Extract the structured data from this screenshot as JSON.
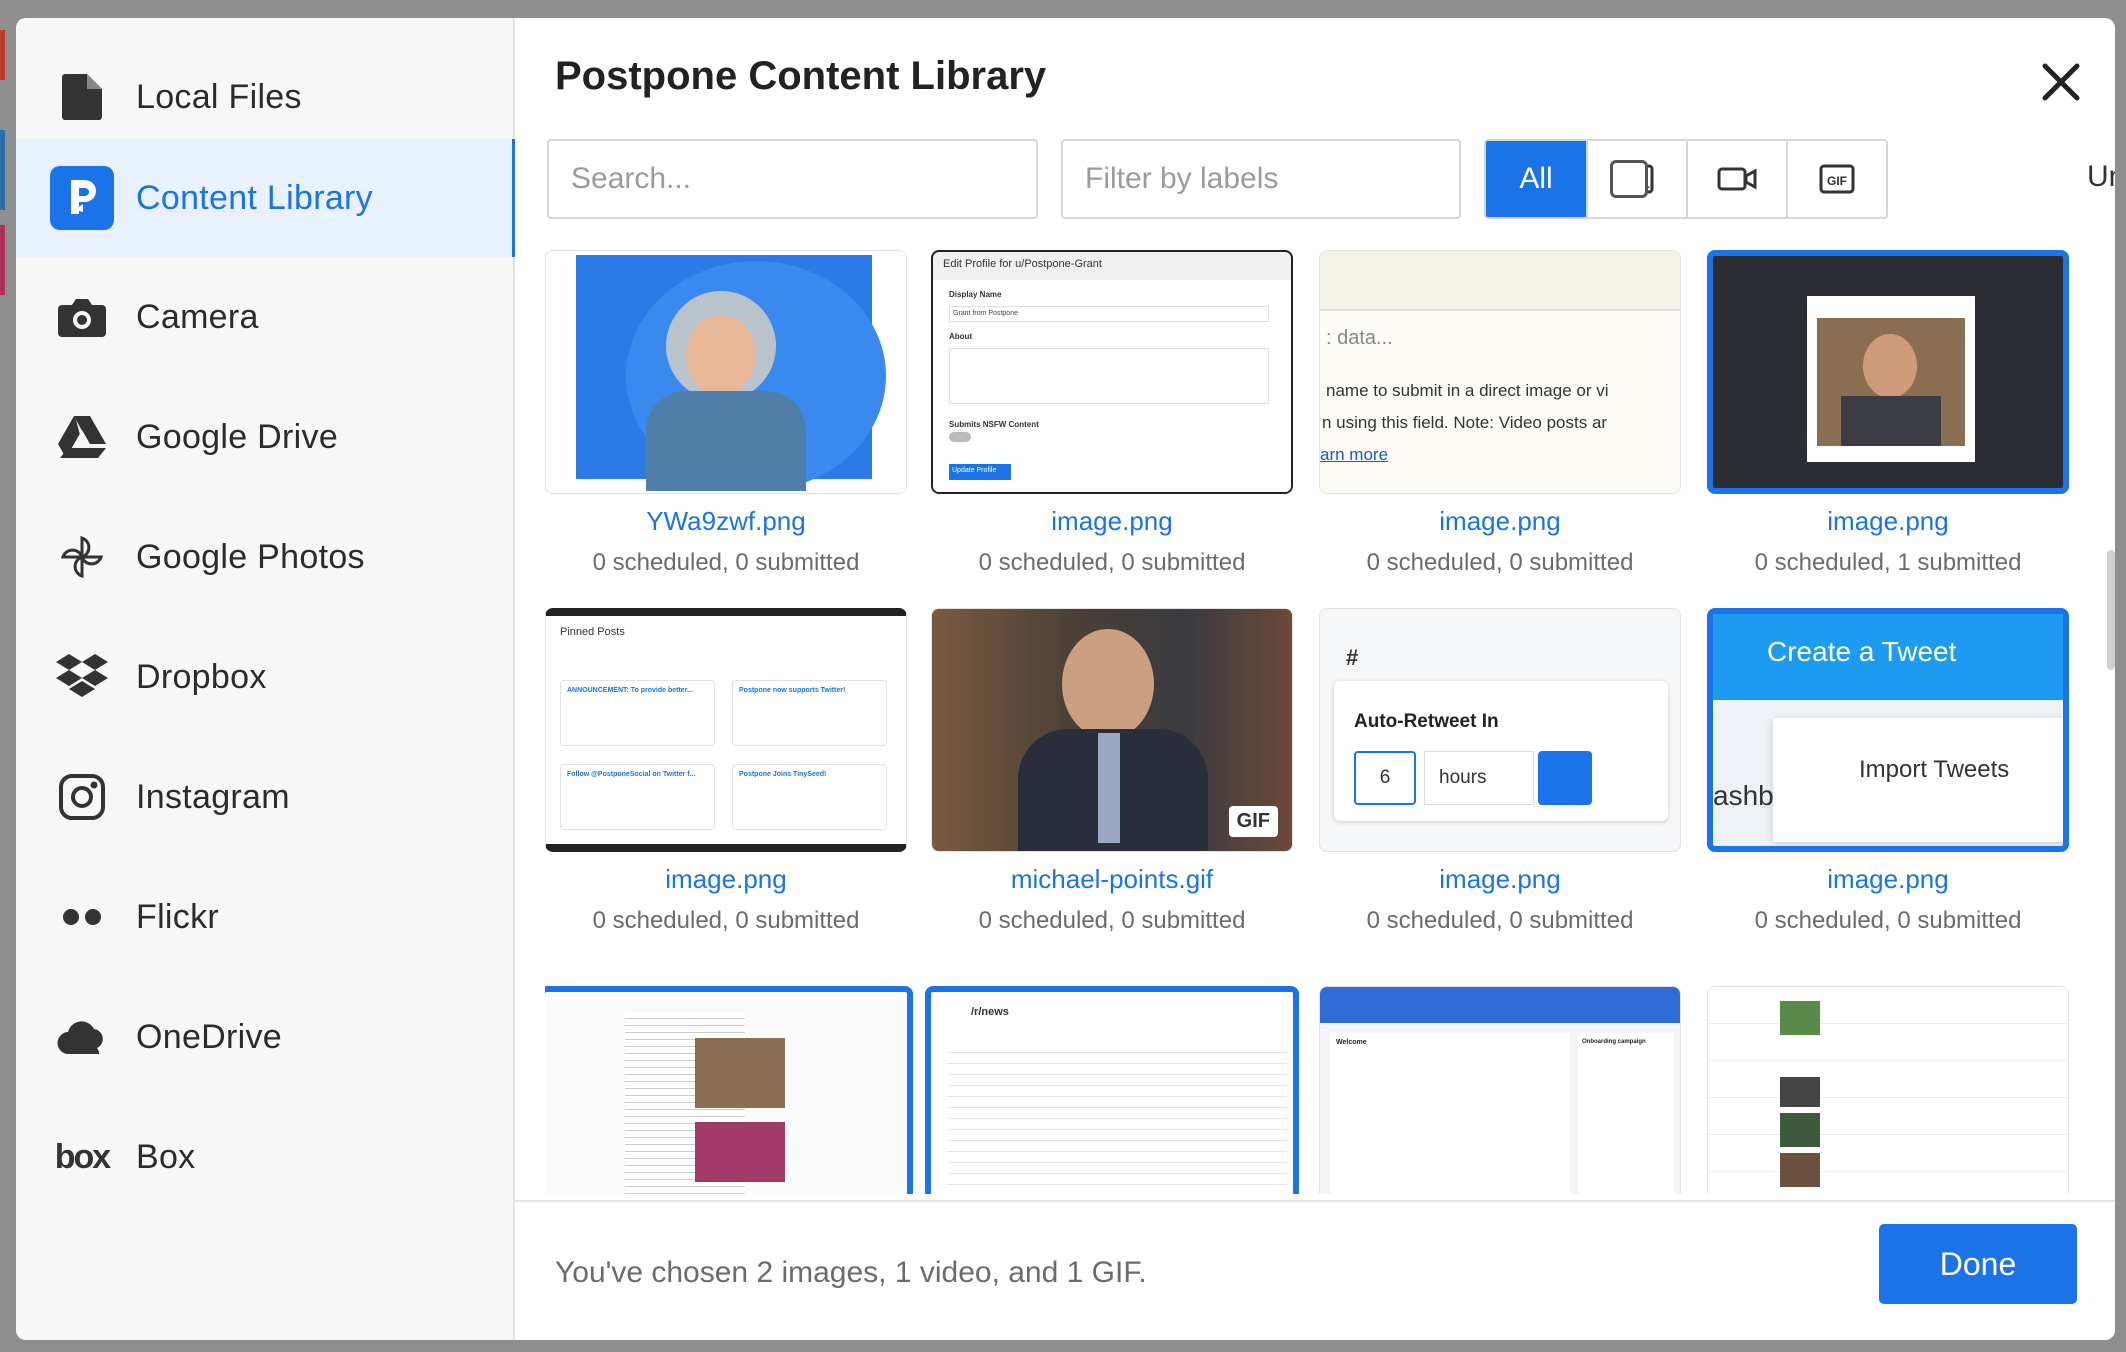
{
  "sidebar": {
    "items": [
      {
        "label": "Local Files",
        "icon": "file-icon"
      },
      {
        "label": "Content Library",
        "icon": "postpone-icon"
      },
      {
        "label": "Camera",
        "icon": "camera-icon"
      },
      {
        "label": "Google Drive",
        "icon": "google-drive-icon"
      },
      {
        "label": "Google Photos",
        "icon": "pinwheel-icon"
      },
      {
        "label": "Dropbox",
        "icon": "dropbox-icon"
      },
      {
        "label": "Instagram",
        "icon": "instagram-icon"
      },
      {
        "label": "Flickr",
        "icon": "flickr-icon"
      },
      {
        "label": "OneDrive",
        "icon": "cloud-icon"
      },
      {
        "label": "Box",
        "icon": "box-logo-icon"
      }
    ],
    "box_logo": "box"
  },
  "main": {
    "title": "Postpone Content Library",
    "search_placeholder": "Search...",
    "filter_placeholder": "Filter by labels",
    "type_filter": {
      "all_label": "All",
      "selected": "All"
    },
    "unused_label": "Unused"
  },
  "cards": [
    {
      "name": "YWa9zwf.png",
      "stats": "0 scheduled, 0 submitted"
    },
    {
      "name": "image.png",
      "stats": "0 scheduled, 0 submitted",
      "text1": "Edit Profile for u/Postpone-Grant",
      "text2": "Display Name",
      "text3": "Grant from Postpone",
      "text4": "About",
      "text5": "Submits NSFW Content",
      "text6": "Update Profile"
    },
    {
      "name": "image.png",
      "stats": "0 scheduled, 0 submitted",
      "text1": ": data...",
      "text2": "name to submit in a direct image or vi",
      "text3": "n using this field. Note: Video posts ar",
      "text4": "arn more"
    },
    {
      "name": "image.png",
      "stats": "0 scheduled, 1 submitted"
    },
    {
      "name": "image.png",
      "stats": "0 scheduled, 0 submitted",
      "text1": "Pinned Posts",
      "text2": "ANNOUNCEMENT: To provide better...",
      "text3": "Postpone now supports Twitter!",
      "text4": "Follow @PostponeSocial on Twitter f...",
      "text5": "Postpone Joins TinySeed!"
    },
    {
      "name": "michael-points.gif",
      "stats": "0 scheduled, 0 submitted",
      "badge": "GIF"
    },
    {
      "name": "image.png",
      "stats": "0 scheduled, 0 submitted",
      "text1": "Auto-Retweet In",
      "text2": "6",
      "text3": "hours",
      "text4": "#"
    },
    {
      "name": "image.png",
      "stats": "0 scheduled, 0 submitted",
      "text1": "Create a Tweet",
      "text2": "Import Tweets",
      "text3": "ashb"
    },
    {
      "name": "",
      "stats": ""
    },
    {
      "name": "",
      "stats": "",
      "text1": "/r/news"
    },
    {
      "name": "",
      "stats": "",
      "text1": "Welcome",
      "text2": "Onboarding campaign"
    },
    {
      "name": "",
      "stats": ""
    }
  ],
  "footer": {
    "summary": "You've chosen 2 images, 1 video, and 1 GIF.",
    "done_label": "Done"
  },
  "colors": {
    "accent": "#1a73e8",
    "sidebar_bg": "#f7f7f8",
    "active_bg": "#e8f1fc"
  }
}
